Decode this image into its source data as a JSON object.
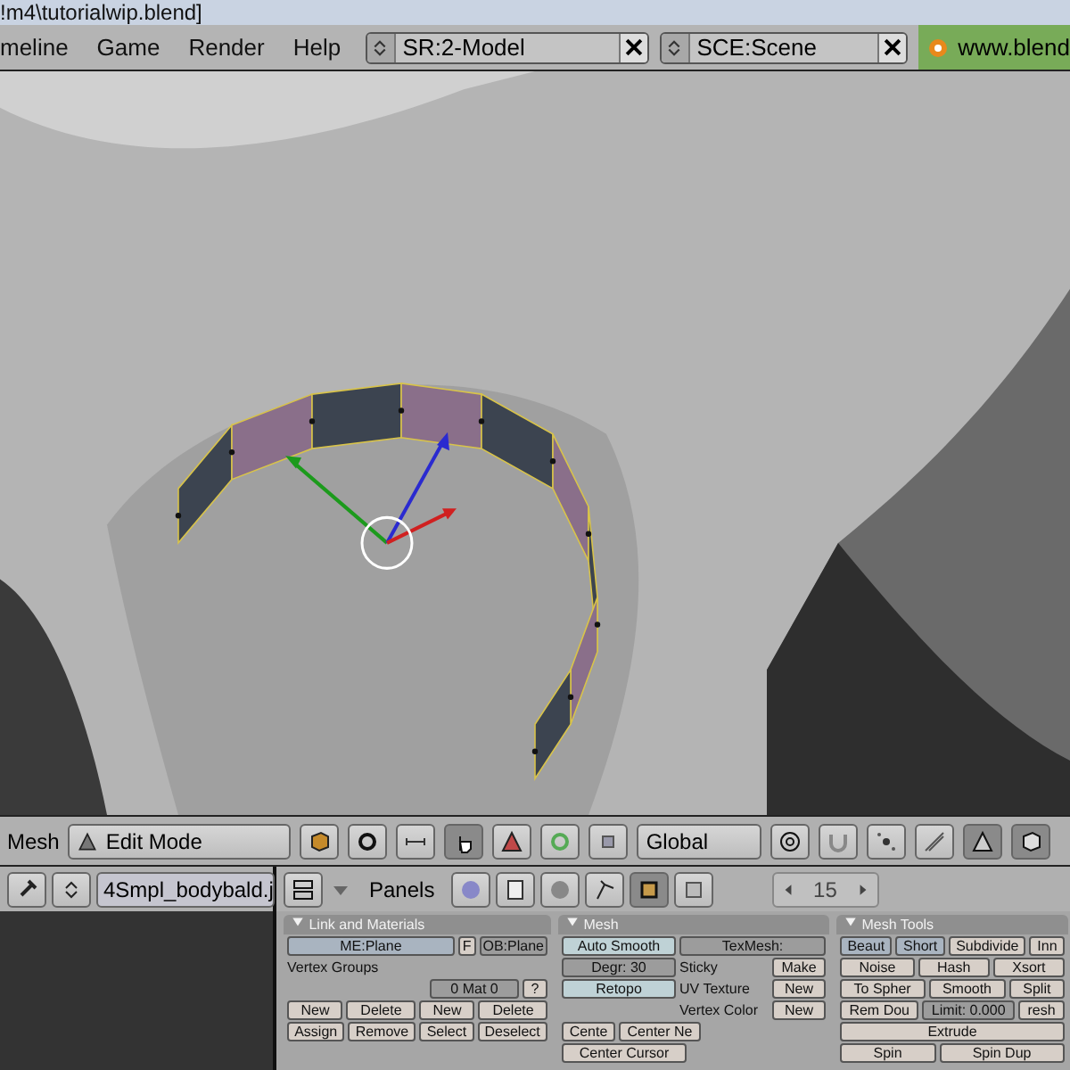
{
  "title_bar": {
    "title": "!m4\\tutorialwip.blend]"
  },
  "menu_bar": {
    "menus": [
      "meline",
      "Game",
      "Render",
      "Help"
    ],
    "screen": "SR:2-Model",
    "scene": "SCE:Scene",
    "link": "www.blend"
  },
  "view_header": {
    "menu": "Mesh",
    "mode": "Edit Mode",
    "orientation": "Global",
    "select_modes": [
      {
        "kind": "vertex",
        "selected": false
      },
      {
        "kind": "edge",
        "selected": false
      },
      {
        "kind": "face",
        "selected": true
      }
    ]
  },
  "file_header": {
    "file": "4Smpl_bodybald.j"
  },
  "buttons_header": {
    "label": "Panels",
    "frame": "15"
  },
  "link_materials": {
    "title": "Link and Materials",
    "mesh": "ME:Plane",
    "flag": "F",
    "object": "OB:Plane",
    "vertex_groups": "Vertex Groups",
    "material": "0 Mat 0",
    "help": "?",
    "group_buttons": [
      "New",
      "Delete",
      "Assign",
      "Remove"
    ],
    "material_buttons": [
      "New",
      "Delete",
      "Select",
      "Deselect"
    ]
  },
  "mesh": {
    "title": "Mesh",
    "auto_smooth": "Auto Smooth",
    "degree": "Degr: 30",
    "retopo": "Retopo",
    "center_buttons": [
      "Cente",
      "Center Ne"
    ],
    "center_cursor": "Center Cursor",
    "texmesh": "TexMesh:",
    "rows": [
      {
        "label": "Sticky",
        "button": "Make"
      },
      {
        "label": "UV Texture",
        "button": "New"
      },
      {
        "label": "Vertex Color",
        "button": "New"
      }
    ]
  },
  "mesh_tools": {
    "title": "Mesh Tools",
    "rows": [
      [
        {
          "label": "Beaut",
          "kind": "toggle"
        },
        {
          "label": "Short",
          "kind": "toggle"
        },
        {
          "label": "Subdivide",
          "kind": "button"
        },
        {
          "label": "Inn",
          "kind": "button"
        }
      ],
      [
        {
          "label": "Noise",
          "kind": "button"
        },
        {
          "label": "Hash",
          "kind": "button"
        },
        {
          "label": "Xsort",
          "kind": "button"
        }
      ],
      [
        {
          "label": "To Spher",
          "kind": "button"
        },
        {
          "label": "Smooth",
          "kind": "button"
        },
        {
          "label": "Split",
          "kind": "button"
        }
      ],
      [
        {
          "label": "Rem Dou",
          "kind": "button"
        },
        {
          "label": "Limit: 0.000",
          "kind": "number"
        },
        {
          "label": "resh",
          "kind": "button"
        }
      ]
    ],
    "extrude": "Extrude",
    "spin_buttons": [
      "Spin",
      "Spin Dup"
    ]
  }
}
